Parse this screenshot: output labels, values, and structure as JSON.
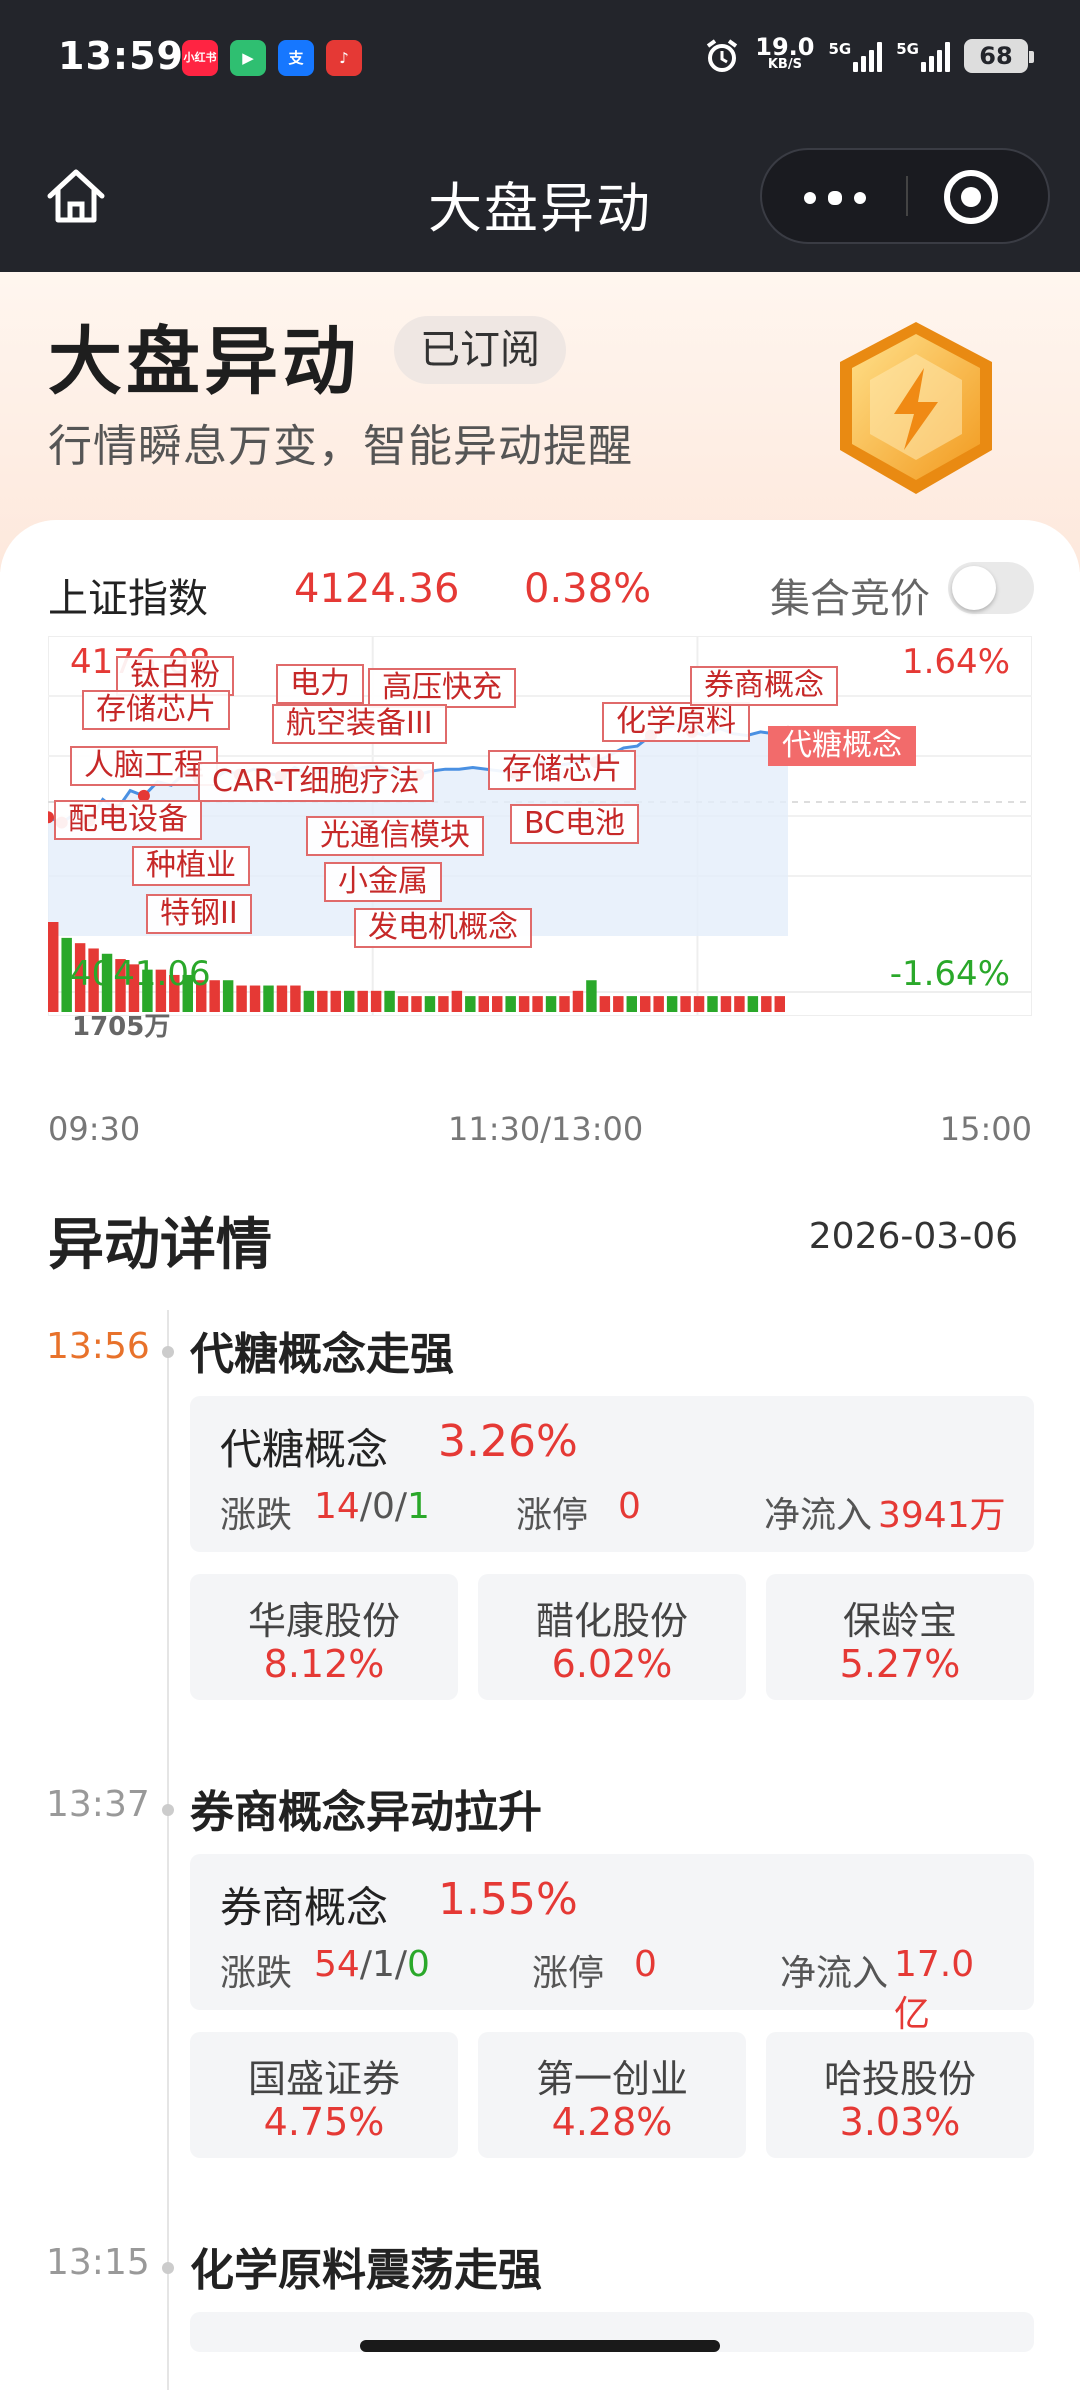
{
  "status_bar": {
    "time": "13:59",
    "apps": [
      {
        "icon": "xiaohongshu-icon",
        "label": "小红书",
        "color": "#ff2442"
      },
      {
        "icon": "video-icon",
        "label": "▶",
        "color": "#2fbf71"
      },
      {
        "icon": "alipay-icon",
        "label": "支",
        "color": "#1677ff"
      },
      {
        "icon": "music-icon",
        "label": "♪",
        "color": "#e53935"
      }
    ],
    "net_speed": "19.0",
    "net_unit": "KB/S",
    "sig1": "5G",
    "sig2": "5G",
    "battery": "68"
  },
  "nav": {
    "title": "大盘异动"
  },
  "hero": {
    "title": "大盘异动",
    "badge": "已订阅",
    "subtitle": "行情瞬息万变，智能异动提醒"
  },
  "index": {
    "name": "上证指数",
    "value": "4124.36",
    "pct": "0.38%",
    "auction_label": "集合竞价",
    "auction_on": false
  },
  "chart_labels": {
    "high": "4176.08",
    "low": "4041.06",
    "high_pct": "1.64%",
    "low_pct": "-1.64%",
    "volume": "1705万",
    "t_open": "09:30",
    "t_mid": "11:30/13:00",
    "t_close": "15:00"
  },
  "chart_data": {
    "type": "line",
    "title": "上证指数",
    "ylim": [
      4041.06,
      4176.08
    ],
    "prev_close": 4108.57,
    "x_range": [
      "09:30",
      "15:00"
    ],
    "series": [
      {
        "values": [
          4100,
          4097,
          4102,
          4098,
          4110,
          4104,
          4115,
          4112,
          4120,
          4118,
          4125,
          4122,
          4121,
          4126,
          4124,
          4127,
          4125,
          4123,
          4128,
          4124,
          4126,
          4125,
          4127,
          4128,
          4129,
          4126,
          4125,
          4124,
          4126,
          4127,
          4127,
          4128,
          4127,
          4126,
          4125,
          4128,
          4131,
          4129,
          4130,
          4132,
          4131,
          4135,
          4139,
          4140,
          4146,
          4150,
          4152,
          4148,
          4146,
          4150,
          4147,
          4146,
          4148,
          4147,
          4148
        ]
      }
    ],
    "volume": [
      17,
      14,
      13,
      12,
      11,
      10,
      9,
      8,
      8,
      7,
      7,
      6,
      6,
      6,
      5,
      5,
      5,
      5,
      5,
      4,
      4,
      4,
      4,
      4,
      4,
      4,
      3,
      3,
      3,
      3,
      4,
      3,
      3,
      3,
      3,
      3,
      3,
      3,
      3,
      4,
      6,
      3,
      3,
      3,
      3,
      3,
      3,
      3,
      3,
      3,
      3,
      3,
      3,
      3,
      3
    ]
  },
  "tags": [
    {
      "label": "钛白粉"
    },
    {
      "label": "存储芯片"
    },
    {
      "label": "人脑工程"
    },
    {
      "label": "配电设备"
    },
    {
      "label": "种植业"
    },
    {
      "label": "特钢II"
    },
    {
      "label": "电力"
    },
    {
      "label": "高压快充"
    },
    {
      "label": "航空装备III"
    },
    {
      "label": "CAR-T细胞疗法"
    },
    {
      "label": "光通信模块"
    },
    {
      "label": "小金属"
    },
    {
      "label": "发电机概念"
    },
    {
      "label": "存储芯片"
    },
    {
      "label": "BC电池"
    },
    {
      "label": "化学原料"
    },
    {
      "label": "券商概念"
    },
    {
      "label": "代糖概念"
    }
  ],
  "detail": {
    "title": "异动详情",
    "date": "2026-03-06"
  },
  "events": [
    {
      "time": "13:56",
      "title": "代糖概念走强",
      "sector": "代糖概念",
      "sector_pct": "3.26%",
      "rf_label": "涨跌",
      "rise": "14",
      "flat": "0",
      "fall": "1",
      "limit_label": "涨停",
      "limit": "0",
      "flow_label": "净流入",
      "flow": "3941万",
      "stocks": [
        {
          "name": "华康股份",
          "pct": "8.12%"
        },
        {
          "name": "醋化股份",
          "pct": "6.02%"
        },
        {
          "name": "保龄宝",
          "pct": "5.27%"
        }
      ]
    },
    {
      "time": "13:37",
      "title": "券商概念异动拉升",
      "sector": "券商概念",
      "sector_pct": "1.55%",
      "rf_label": "涨跌",
      "rise": "54",
      "flat": "1",
      "fall": "0",
      "limit_label": "涨停",
      "limit": "0",
      "flow_label": "净流入",
      "flow": "17.0亿",
      "stocks": [
        {
          "name": "国盛证券",
          "pct": "4.75%"
        },
        {
          "name": "第一创业",
          "pct": "4.28%"
        },
        {
          "name": "哈投股份",
          "pct": "3.03%"
        }
      ]
    },
    {
      "time": "13:15",
      "title": "化学原料震荡走强"
    }
  ]
}
